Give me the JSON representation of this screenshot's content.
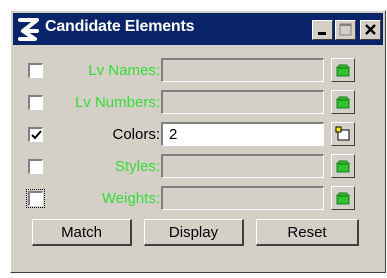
{
  "window": {
    "title": "Candidate Elements",
    "controls": [
      "minimize-icon",
      "maximize-icon",
      "close-icon"
    ]
  },
  "rows": [
    {
      "label": "Lv Names:",
      "checked": false,
      "enabled": false,
      "value": ""
    },
    {
      "label": "Lv Numbers:",
      "checked": false,
      "enabled": false,
      "value": ""
    },
    {
      "label": "Colors:",
      "checked": true,
      "enabled": true,
      "value": "2"
    },
    {
      "label": "Styles:",
      "checked": false,
      "enabled": false,
      "value": ""
    },
    {
      "label": "Weights:",
      "checked": false,
      "enabled": false,
      "value": ""
    }
  ],
  "buttons": {
    "match": "Match",
    "display": "Display",
    "reset": "Reset"
  },
  "colors": {
    "titlebar": "#0a246a",
    "disabled_label": "#33dd33",
    "face": "#d4d0c8"
  }
}
